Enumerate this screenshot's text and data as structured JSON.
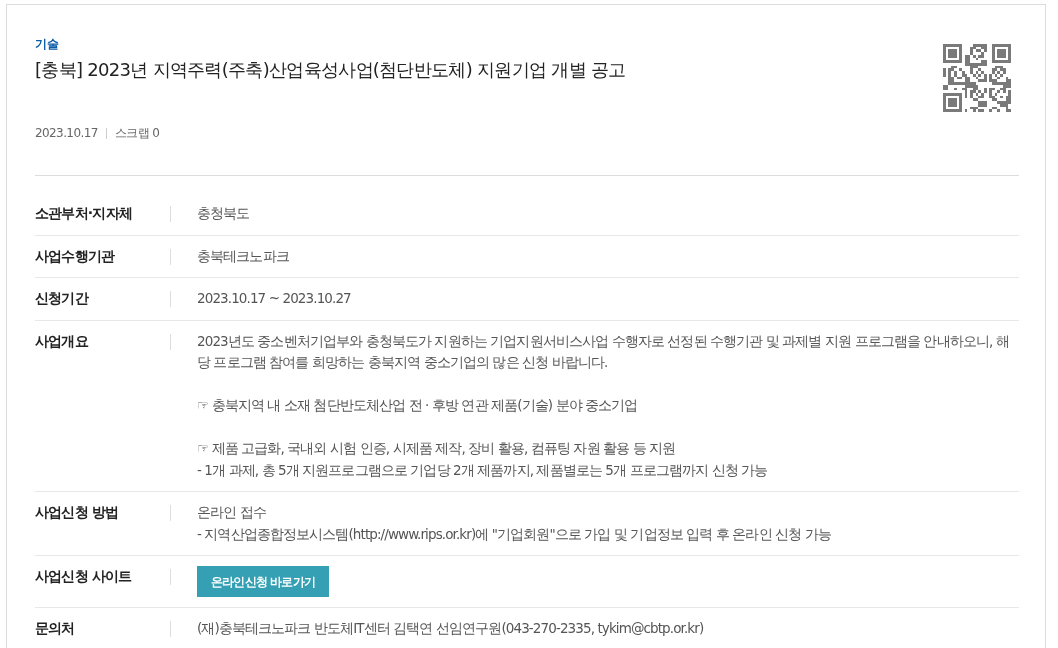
{
  "category": "기술",
  "title": "[충북] 2023년 지역주력(주축)산업육성사업(첨단반도체) 지원기업 개별 공고",
  "meta": {
    "date": "2023.10.17",
    "scrap": "스크랩 0"
  },
  "details": [
    {
      "label": "소관부처·지자체",
      "kind": "text",
      "paragraphs": [
        [
          "충청북도"
        ]
      ]
    },
    {
      "label": "사업수행기관",
      "kind": "text",
      "paragraphs": [
        [
          "충북테크노파크"
        ]
      ]
    },
    {
      "label": "신청기간",
      "kind": "text",
      "paragraphs": [
        [
          "2023.10.17 ~ 2023.10.27"
        ]
      ]
    },
    {
      "label": "사업개요",
      "kind": "text",
      "paragraphs": [
        [
          "2023년도 중소벤처기업부와 충청북도가 지원하는 기업지원서비스사업 수행자로 선정된 수행기관 및 과제별 지원 프로그램을 안내하오니, 해당 프로그램 참여를 희망하는 충북지역 중소기업의 많은 신청 바랍니다."
        ],
        [
          "☞ 충북지역 내 소재 첨단반도체산업 전 · 후방 연관 제품(기술) 분야 중소기업"
        ],
        [
          "☞ 제품 고급화, 국내외 시험 인증, 시제품 제작, 장비 활용, 컴퓨팅 자원 활용 등 지원",
          "- 1개 과제, 총 5개 지원프로그램으로 기업당 2개 제품까지, 제품별로는 5개 프로그램까지 신청 가능"
        ]
      ]
    },
    {
      "label": "사업신청 방법",
      "kind": "text",
      "paragraphs": [
        [
          "온라인 접수",
          "- 지역산업종합정보시스템(http://www.rips.or.kr)에 \"기업회원\"으로 가입 및 기업정보 입력 후 온라인 신청 가능"
        ]
      ]
    },
    {
      "label": "사업신청 사이트",
      "kind": "button",
      "button": "온라인신청 바로가기"
    },
    {
      "label": "문의처",
      "kind": "text",
      "paragraphs": [
        [
          "(재)충북테크노파크 반도체IT센터 김택연 선임연구원(043-270-2335, tykim@cbtp.or.kr)"
        ]
      ]
    }
  ]
}
